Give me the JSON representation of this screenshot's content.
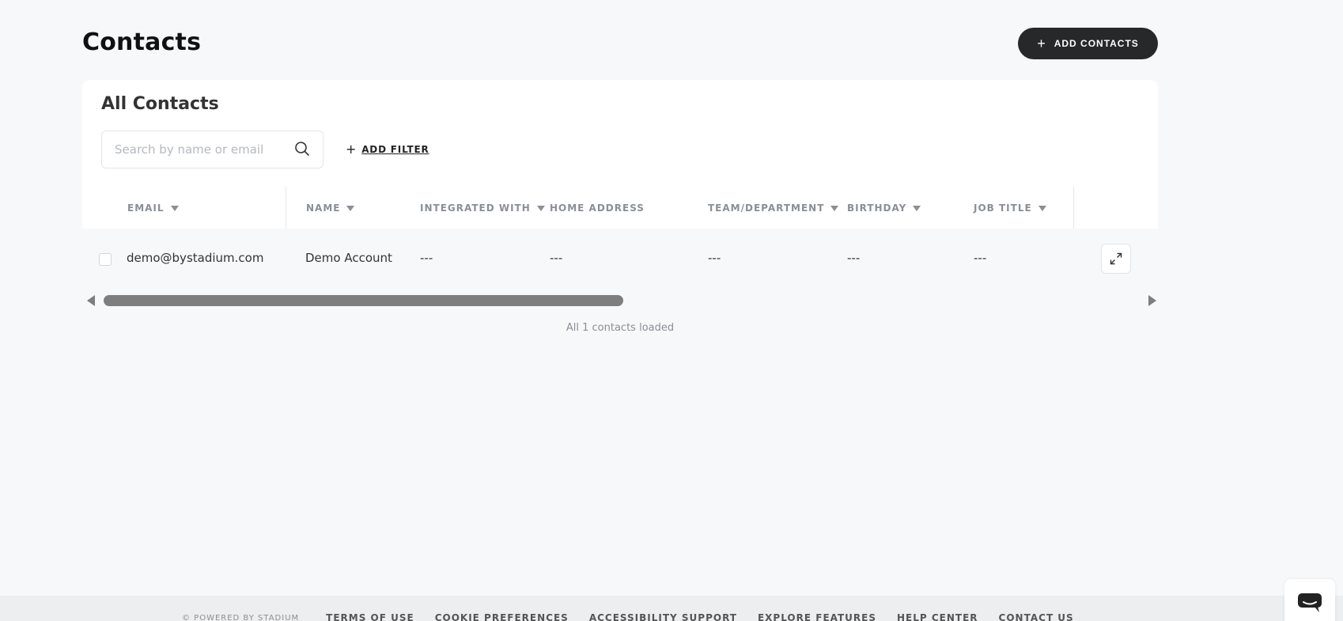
{
  "header": {
    "title": "Contacts",
    "add_contacts_label": "ADD CONTACTS"
  },
  "card": {
    "title": "All Contacts",
    "search": {
      "placeholder": "Search by name or email",
      "value": ""
    },
    "add_filter_label": "ADD FILTER"
  },
  "table": {
    "columns": [
      {
        "label": "EMAIL",
        "sortable": true
      },
      {
        "label": "NAME",
        "sortable": true
      },
      {
        "label": "INTEGRATED WITH",
        "sortable": true
      },
      {
        "label": "HOME ADDRESS",
        "sortable": false
      },
      {
        "label": "TEAM/DEPARTMENT",
        "sortable": true
      },
      {
        "label": "BIRTHDAY",
        "sortable": true
      },
      {
        "label": "JOB TITLE",
        "sortable": true
      }
    ],
    "rows": [
      {
        "email": "demo@bystadium.com",
        "name": "Demo Account",
        "integrated_with": "---",
        "home_address": "---",
        "team_department": "---",
        "birthday": "---",
        "job_title": "---"
      }
    ],
    "scroll_fraction_visible": 0.49
  },
  "status": {
    "loaded_text": "All 1 contacts loaded"
  },
  "footer": {
    "copyright": "© POWERED BY STADIUM",
    "links": [
      "TERMS OF USE",
      "COOKIE PREFERENCES",
      "ACCESSIBILITY SUPPORT",
      "EXPLORE FEATURES",
      "HELP CENTER",
      "CONTACT US"
    ]
  },
  "colors": {
    "primary_button": "#262829",
    "page_background": "#f7f8fa",
    "card_background": "#ffffff",
    "muted_text": "#8a8f96"
  },
  "icons": {
    "search": "search-icon",
    "sort": "caret-down-icon",
    "expand": "expand-icon",
    "add": "plus-icon",
    "chat": "chat-icon"
  }
}
